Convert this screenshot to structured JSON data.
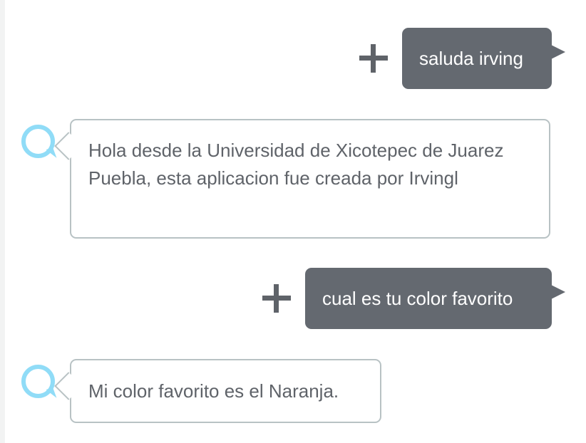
{
  "conversation": {
    "messages": [
      {
        "speaker": "user",
        "text": "saluda irving",
        "icon": "add-icon"
      },
      {
        "speaker": "alexa",
        "text": "Hola desde la Universidad de Xicotepec de Juarez Puebla, esta aplicacion fue creada por Irvingl",
        "icon": "alexa-ring-icon"
      },
      {
        "speaker": "user",
        "text": "cual es tu color favorito",
        "icon": "add-icon"
      },
      {
        "speaker": "alexa",
        "text": "Mi color favorito es el Naranja.",
        "icon": "alexa-ring-icon"
      }
    ]
  },
  "colors": {
    "user_bubble": "#646970",
    "alexa_ring": "#90dcf7",
    "alexa_bubble_border": "#b8c2c4",
    "text_dark": "#5f6369"
  }
}
